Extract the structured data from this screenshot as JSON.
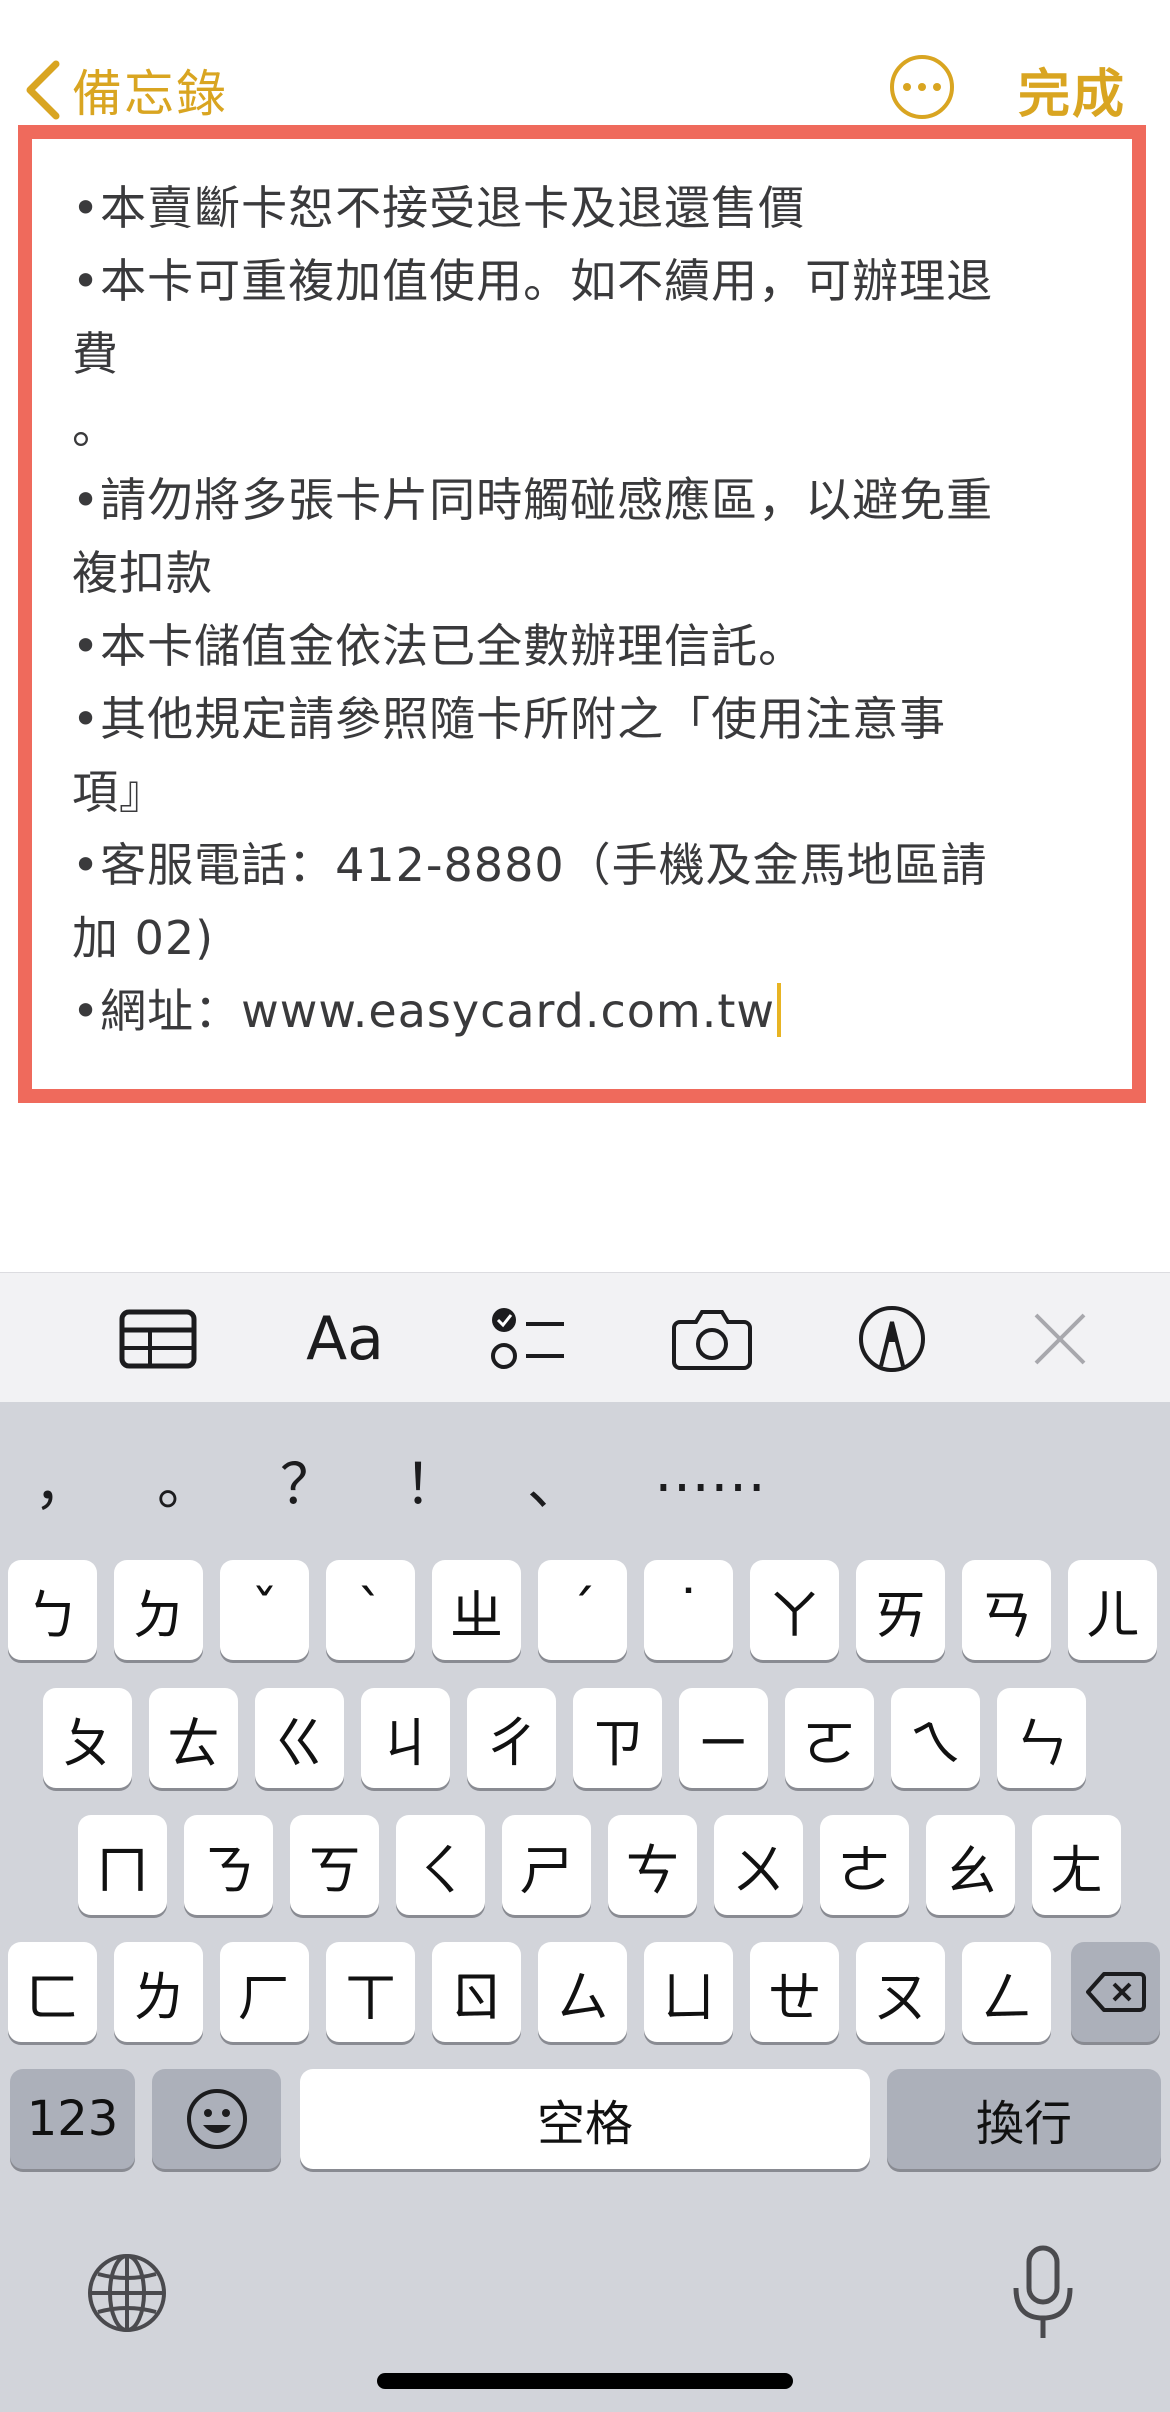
{
  "nav": {
    "back_label": "備忘錄",
    "more_icon": "ellipsis-circle-icon",
    "done_label": "完成"
  },
  "note": {
    "lines": [
      "•本賣斷卡恕不接受退卡及退還售價",
      "•本卡可重複加值使用。如不續用，可辦理退",
      "費",
      "。",
      "•請勿將多張卡片同時觸碰感應區，以避免重",
      "複扣款",
      "•本卡儲值金依法已全數辦理信託。",
      "•其他規定請參照隨卡所附之「使用注意事",
      "項』",
      "•客服電話：412-8880（手機及金馬地區請",
      "加 02)",
      "•網址：www.easycard.com.tw"
    ]
  },
  "toolbar": {
    "icons": [
      "table-icon",
      "text-format-icon",
      "checklist-icon",
      "camera-icon",
      "markup-pen-icon",
      "close-icon"
    ],
    "format_label": "Aa"
  },
  "keyboard": {
    "candidates": [
      "，",
      "。",
      "？",
      "！",
      "、",
      "……"
    ],
    "row1": [
      "ㄅ",
      "ㄉ",
      "ˇ",
      "ˋ",
      "ㄓ",
      "ˊ",
      "˙",
      "ㄚ",
      "ㄞ",
      "ㄢ",
      "ㄦ"
    ],
    "row2": [
      "ㄆ",
      "ㄊ",
      "ㄍ",
      "ㄐ",
      "ㄔ",
      "ㄗ",
      "ㄧ",
      "ㄛ",
      "ㄟ",
      "ㄣ"
    ],
    "row3": [
      "ㄇ",
      "ㄋ",
      "ㄎ",
      "ㄑ",
      "ㄕ",
      "ㄘ",
      "ㄨ",
      "ㄜ",
      "ㄠ",
      "ㄤ"
    ],
    "row4": [
      "ㄈ",
      "ㄌ",
      "ㄏ",
      "ㄒ",
      "ㄖ",
      "ㄙ",
      "ㄩ",
      "ㄝ",
      "ㄡ",
      "ㄥ"
    ],
    "numbers_label": "123",
    "space_label": "空格",
    "return_label": "換行",
    "icons": [
      "delete-icon",
      "emoji-icon",
      "globe-icon",
      "microphone-icon"
    ]
  },
  "colors": {
    "accent": "#d9a521",
    "highlight_frame": "#ef6a5c",
    "keyboard_bg": "#d2d4da"
  }
}
